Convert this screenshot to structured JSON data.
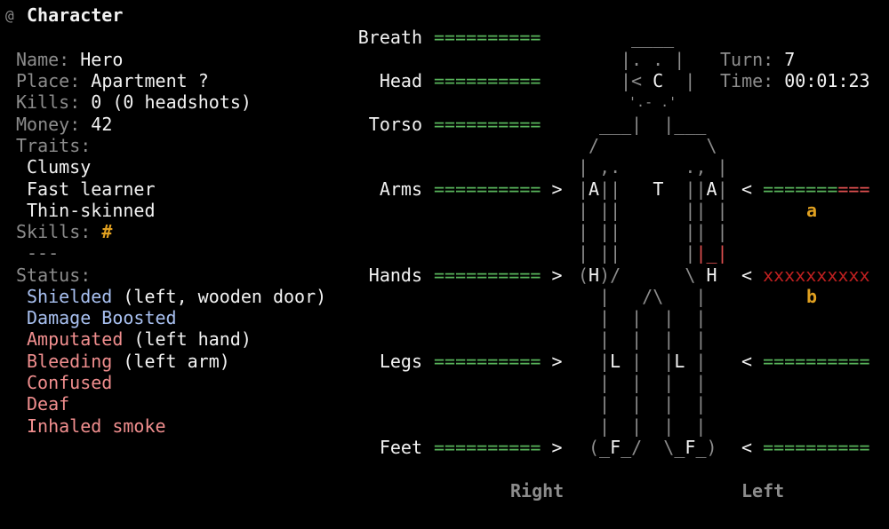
{
  "header": {
    "icon": "@",
    "title": "Character"
  },
  "info": {
    "name_label": "Name:",
    "name": "Hero",
    "place_label": "Place:",
    "place": "Apartment ?",
    "kills_label": "Kills:",
    "kills": "0 (0 headshots)",
    "money_label": "Money:",
    "money": "42",
    "traits_label": "Traits:",
    "traits": [
      "Clumsy",
      "Fast learner",
      "Thin-skinned"
    ],
    "skills_label": "Skills:",
    "skills_icon": "#",
    "skills_none": "---",
    "status_label": "Status:",
    "status": [
      {
        "name": "Shielded",
        "detail": "(left, wooden door)"
      },
      {
        "name": "Damage Boosted",
        "detail": ""
      },
      {
        "name": "Amputated",
        "detail": "(left hand)"
      },
      {
        "name": "Bleeding",
        "detail": "(left arm)"
      },
      {
        "name": "Confused",
        "detail": ""
      },
      {
        "name": "Deaf",
        "detail": ""
      },
      {
        "name": "Inhaled smoke",
        "detail": ""
      }
    ]
  },
  "body_parts": {
    "breath": {
      "label": "Breath",
      "bar": "=========="
    },
    "head": {
      "label": "Head",
      "bar": "=========="
    },
    "torso": {
      "label": "Torso",
      "bar": "=========="
    },
    "arms": {
      "label": "Arms",
      "right_bar": "==========",
      "left_bar_ok": "=======",
      "left_bar_hurt": "===",
      "left_marker": "a"
    },
    "hands": {
      "label": "Hands",
      "right_bar": "==========",
      "left_bar": "xxxxxxxxxx",
      "left_marker": "b"
    },
    "legs": {
      "label": "Legs",
      "right_bar": "==========",
      "left_bar": "=========="
    },
    "feet": {
      "label": "Feet",
      "right_bar": "==========",
      "left_bar": "=========="
    },
    "arrow_right": ">",
    "arrow_left": "<"
  },
  "clock": {
    "turn_label": "Turn:",
    "turn": "7",
    "time_label": "Time:",
    "time": "00:01:23"
  },
  "figure": {
    "head_letter": "C",
    "torso_letter": "T",
    "arm_right_letter": "A",
    "arm_left_letter": "A",
    "hand_right_letter": "H",
    "hand_left_letter": "H",
    "leg_right_letter": "L",
    "leg_left_letter": "L",
    "foot_right_letter": "F",
    "foot_left_letter": "F"
  },
  "footer": {
    "right": "Right",
    "left": "Left"
  },
  "colors": {
    "background": "#000000",
    "healthy": "#59b55b",
    "hurt": "#e05050",
    "lost": "#c02020",
    "marker": "#e0a020",
    "negative_status": "#f08e8e",
    "positive_status": "#a8c0f0"
  }
}
